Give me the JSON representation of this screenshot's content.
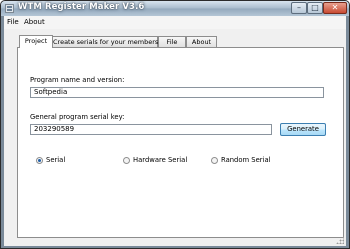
{
  "window": {
    "title": "WTM Register Maker V3.6",
    "controls": {
      "minimize": "–",
      "maximize": "□",
      "close": "✕"
    }
  },
  "menu": {
    "items": [
      {
        "label": "File"
      },
      {
        "label": "About"
      }
    ]
  },
  "tabs": [
    {
      "label": "Project",
      "active": true
    },
    {
      "label": "Create serials for your members",
      "active": false
    },
    {
      "label": "File",
      "active": false
    },
    {
      "label": "About",
      "active": false
    }
  ],
  "project": {
    "name_label": "Program name and version:",
    "name_value": "Softpedia",
    "serial_label": "General program serial key:",
    "serial_value": "203290589",
    "generate_label": "Generate"
  },
  "serial_type": {
    "options": [
      {
        "label": "Serial",
        "selected": true
      },
      {
        "label": "Hardware Serial",
        "selected": false
      },
      {
        "label": "Random Serial",
        "selected": false
      }
    ]
  }
}
